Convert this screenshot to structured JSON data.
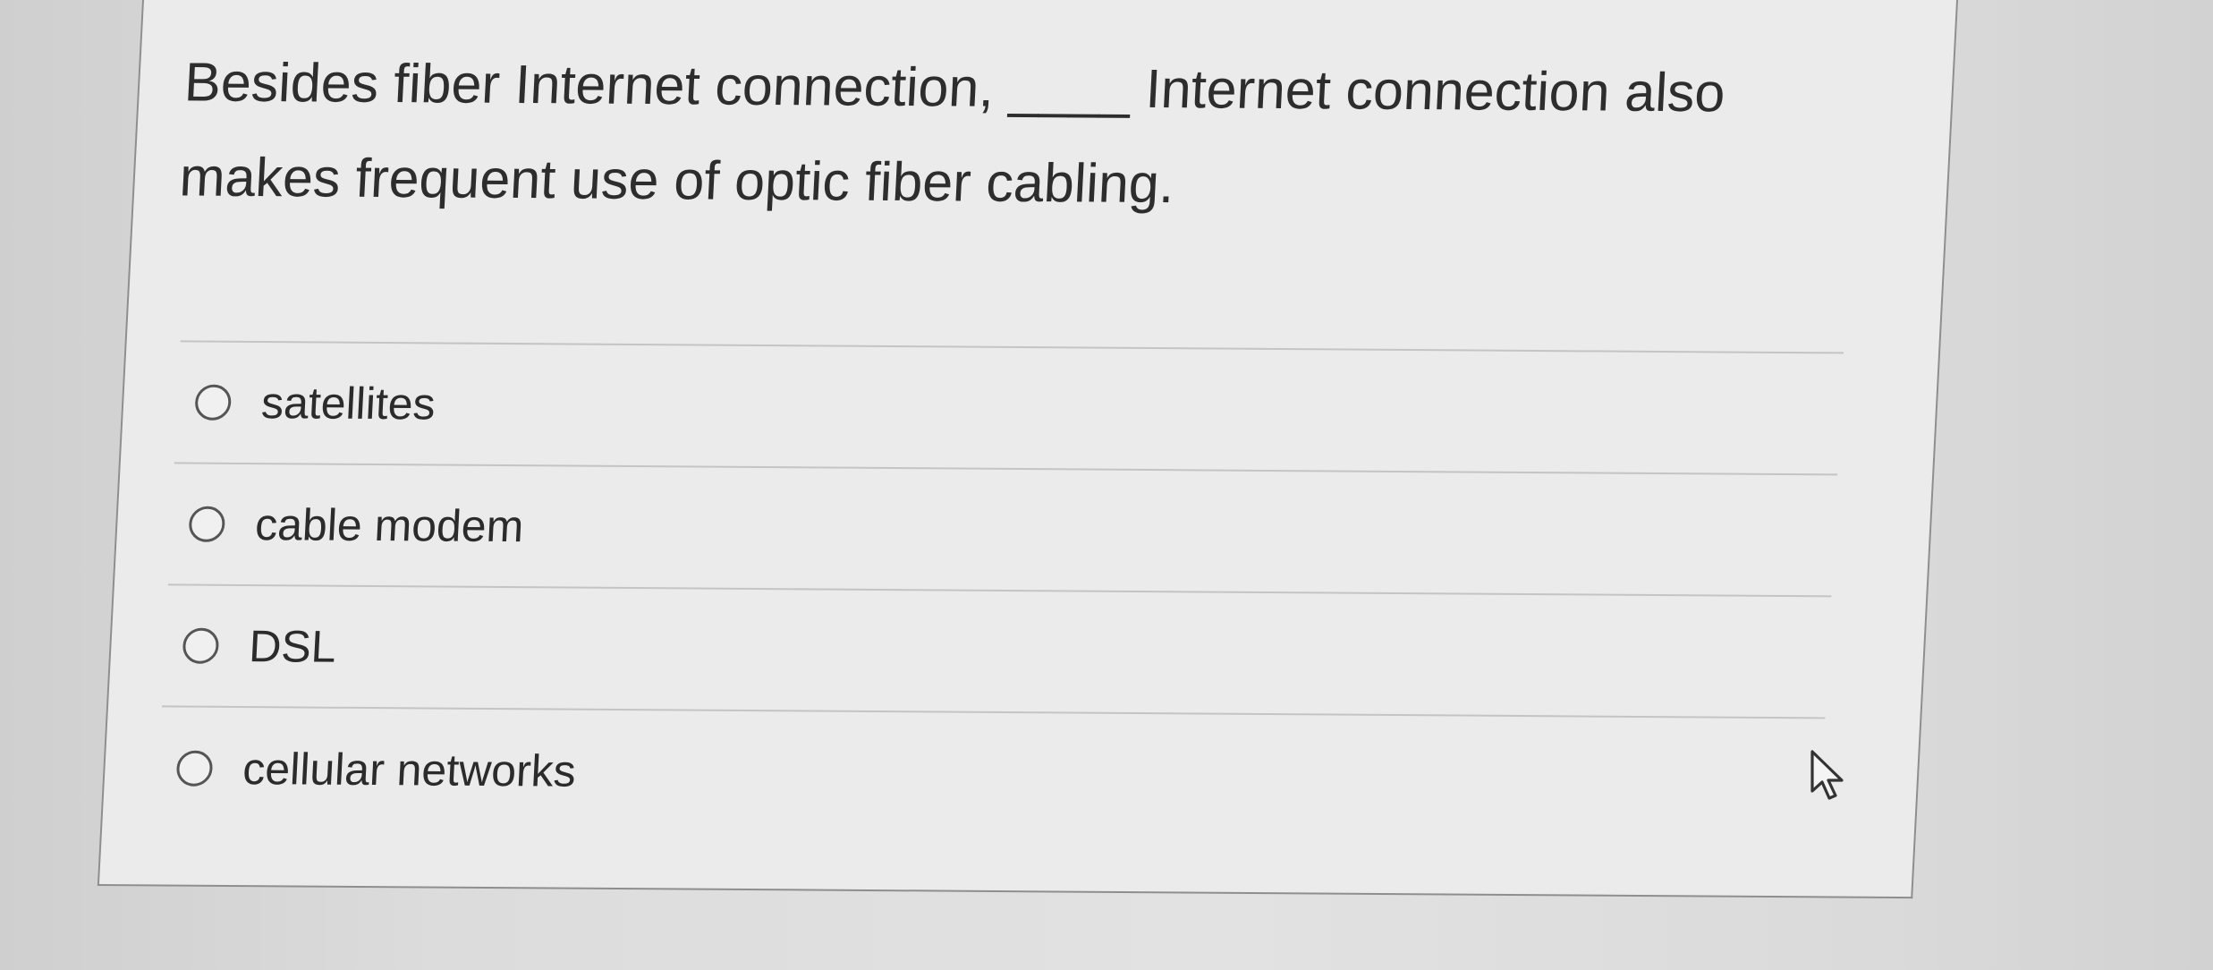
{
  "question": {
    "line1": "Besides fiber Internet connection, ____ Internet connection also",
    "line2": "makes frequent use of optic fiber cabling."
  },
  "choices": [
    {
      "label": "satellites"
    },
    {
      "label": "cable modem"
    },
    {
      "label": "DSL"
    },
    {
      "label": "cellular networks"
    }
  ],
  "colors": {
    "card_background": "#ebebeb",
    "text": "#2b2b2b",
    "divider": "#c4c4c4"
  },
  "icons": {
    "cursor": "mouse-pointer-icon",
    "radio": "radio-unselected"
  }
}
